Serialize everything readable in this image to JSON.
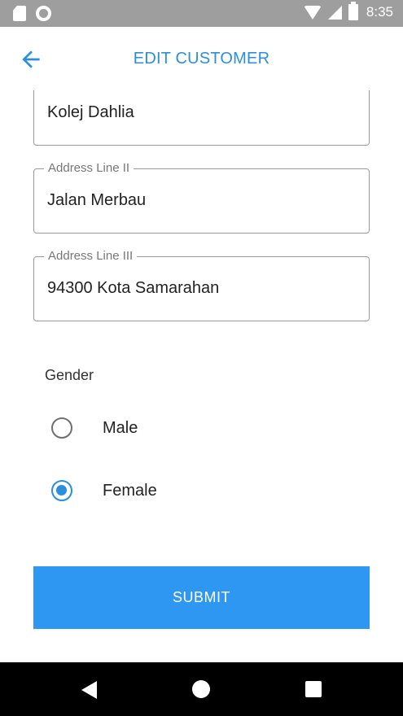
{
  "status_bar": {
    "time": "8:35",
    "icons": [
      "sd-card-icon",
      "sync-circle-icon",
      "wifi-icon",
      "signal-icon",
      "battery-icon"
    ]
  },
  "app_bar": {
    "title": "EDIT CUSTOMER",
    "back_icon": "arrow-back-icon"
  },
  "form": {
    "address_line_1": {
      "value": "Kolej Dahlia"
    },
    "address_line_2": {
      "label": "Address Line II",
      "value": "Jalan Merbau"
    },
    "address_line_3": {
      "label": "Address Line III",
      "value": "94300 Kota Samarahan"
    },
    "gender": {
      "label": "Gender",
      "options": [
        {
          "label": "Male",
          "selected": false
        },
        {
          "label": "Female",
          "selected": true
        }
      ]
    },
    "submit_label": "SUBMIT"
  },
  "colors": {
    "accent": "#2b8fdc",
    "button": "#2d97f1",
    "status_bar": "#9e9e9e",
    "nav_bar": "#000000"
  },
  "nav_bar": {
    "icons": [
      "nav-back-icon",
      "nav-home-icon",
      "nav-recents-icon"
    ]
  }
}
